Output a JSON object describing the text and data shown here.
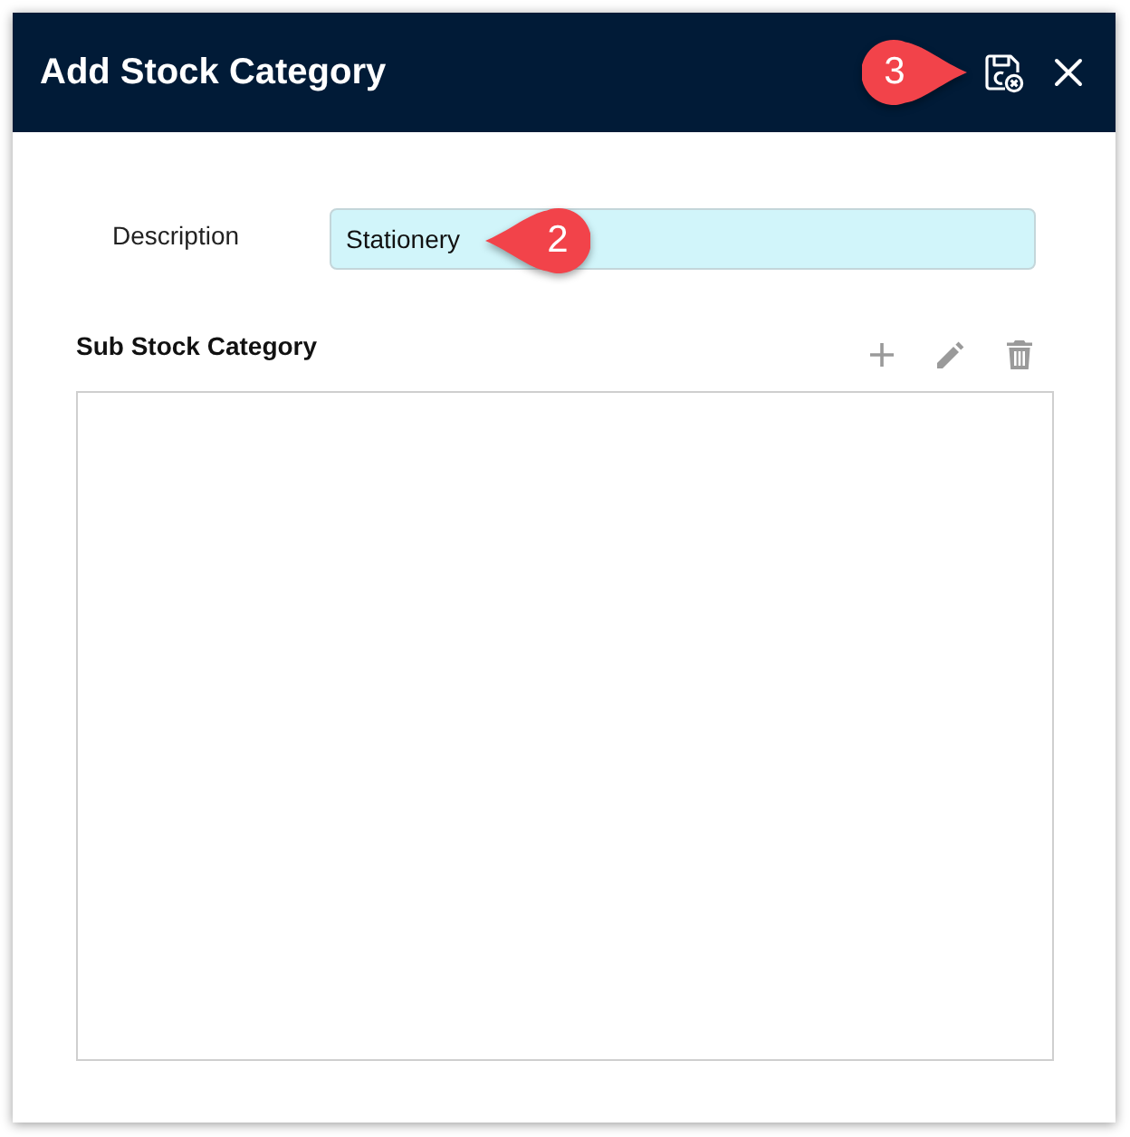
{
  "window": {
    "title": "Add Stock Category",
    "callout": "3"
  },
  "form": {
    "fields": [
      {
        "label": "Description",
        "value": "Stationery",
        "callout": "2"
      }
    ]
  },
  "sub_stock_category": {
    "title": "Sub Stock Category"
  }
}
